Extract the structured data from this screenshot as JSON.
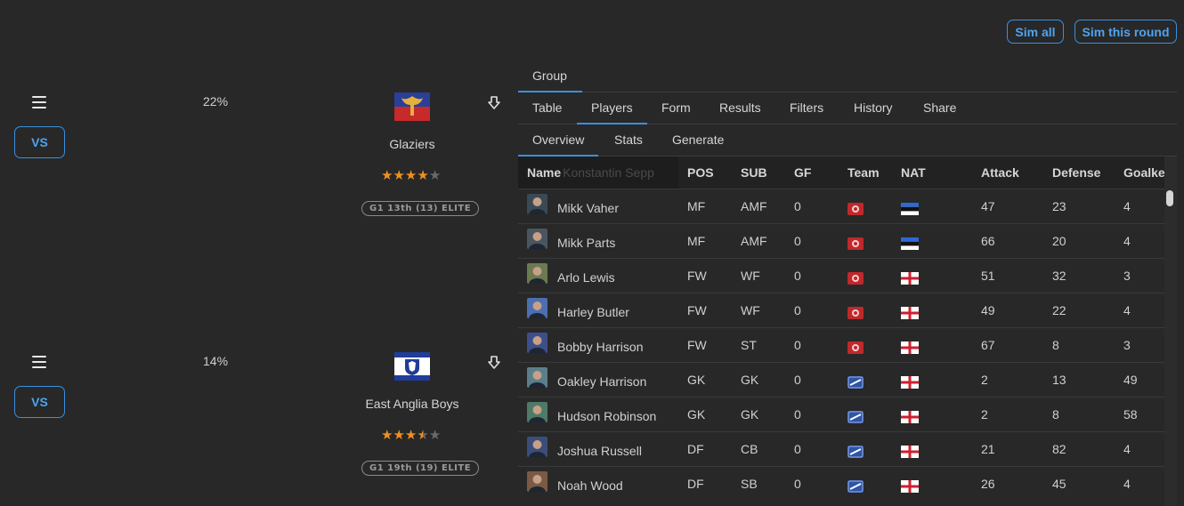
{
  "top_buttons": {
    "sim_all": "Sim all",
    "sim_round": "Sim this round"
  },
  "matches": [
    {
      "percent": "22%",
      "vs_label": "VS",
      "team": "Glaziers",
      "rating": 4,
      "badge": "G1 13th (13) ELITE"
    },
    {
      "percent": "14%",
      "vs_label": "VS",
      "team": "East Anglia Boys",
      "rating": 3.5,
      "badge": "G1 19th (19) ELITE"
    }
  ],
  "tabs": {
    "level1": [
      "Group"
    ],
    "level2": [
      "Table",
      "Players",
      "Form",
      "Results",
      "Filters",
      "History",
      "Share"
    ],
    "level2_active": "Players",
    "level3": [
      "Overview",
      "Stats",
      "Generate"
    ],
    "level3_active": "Overview"
  },
  "table": {
    "columns": [
      "Name",
      "POS",
      "SUB",
      "GF",
      "Team",
      "NAT",
      "Attack",
      "Defense",
      "Goalke"
    ],
    "ghost_text": "Konstantin Sepp",
    "rows": [
      {
        "name": "Mikk Vaher",
        "pos": "MF",
        "sub": "AMF",
        "gf": "0",
        "team": "glaziers",
        "nat": "estonia",
        "attack": "47",
        "defense": "23",
        "gk": "4"
      },
      {
        "name": "Mikk Parts",
        "pos": "MF",
        "sub": "AMF",
        "gf": "0",
        "team": "glaziers",
        "nat": "estonia",
        "attack": "66",
        "defense": "20",
        "gk": "4"
      },
      {
        "name": "Arlo Lewis",
        "pos": "FW",
        "sub": "WF",
        "gf": "0",
        "team": "glaziers",
        "nat": "england",
        "attack": "51",
        "defense": "32",
        "gk": "3"
      },
      {
        "name": "Harley Butler",
        "pos": "FW",
        "sub": "WF",
        "gf": "0",
        "team": "glaziers",
        "nat": "england",
        "attack": "49",
        "defense": "22",
        "gk": "4"
      },
      {
        "name": "Bobby Harrison",
        "pos": "FW",
        "sub": "ST",
        "gf": "0",
        "team": "glaziers",
        "nat": "england",
        "attack": "67",
        "defense": "8",
        "gk": "3"
      },
      {
        "name": "Oakley Harrison",
        "pos": "GK",
        "sub": "GK",
        "gf": "0",
        "team": "east-anglia",
        "nat": "england",
        "attack": "2",
        "defense": "13",
        "gk": "49"
      },
      {
        "name": "Hudson Robinson",
        "pos": "GK",
        "sub": "GK",
        "gf": "0",
        "team": "east-anglia",
        "nat": "england",
        "attack": "2",
        "defense": "8",
        "gk": "58"
      },
      {
        "name": "Joshua Russell",
        "pos": "DF",
        "sub": "CB",
        "gf": "0",
        "team": "east-anglia",
        "nat": "england",
        "attack": "21",
        "defense": "82",
        "gk": "4"
      },
      {
        "name": "Noah Wood",
        "pos": "DF",
        "sub": "SB",
        "gf": "0",
        "team": "east-anglia",
        "nat": "england",
        "attack": "26",
        "defense": "45",
        "gk": "4"
      }
    ]
  },
  "colors": {
    "accent": "#3a8fe0",
    "star": "#f0901e",
    "background": "#282828"
  }
}
